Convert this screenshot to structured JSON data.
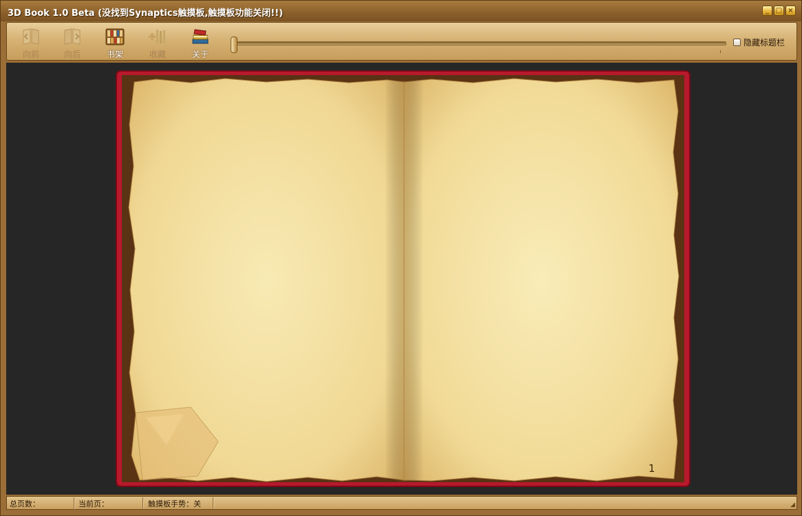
{
  "window": {
    "title": "3D Book 1.0 Beta (没找到Synaptics触摸板,触摸板功能关闭!!)"
  },
  "window_buttons": [
    "minimize-icon",
    "maximize-icon",
    "close-icon"
  ],
  "toolbar": {
    "back_label": "向前",
    "forward_label": "向后",
    "bookshelf_label": "书架",
    "favorites_label": "收藏",
    "about_label": "关于",
    "hide_titlebar_label": "隐藏标题栏",
    "hide_titlebar_checked": false
  },
  "book": {
    "page_number": "1"
  },
  "statusbar": {
    "total_pages_label": "总页数：",
    "current_page_label": "当前页：",
    "touchpad_label": "触摸板手势：关"
  },
  "colors": {
    "cover": "#b8192c",
    "paper": "#f3dfa0",
    "frame": "#9a6e36",
    "background": "#262626"
  }
}
